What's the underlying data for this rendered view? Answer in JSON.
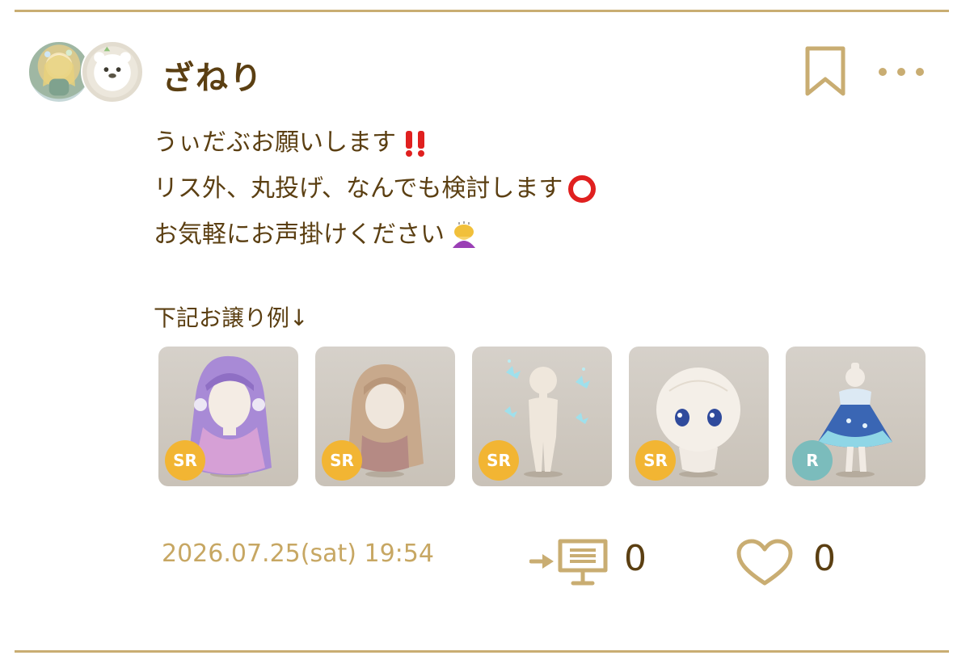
{
  "post": {
    "username": "ざねり",
    "body_lines": [
      "うぃだぶお願いします",
      "リス外、丸投げ、なんでも検討します",
      "お気軽にお声掛けください"
    ],
    "body_emoji_icons": [
      "double-exclamation-icon",
      "red-circle-icon",
      "bowing-person-icon"
    ],
    "section_label": "下記お譲り例↓",
    "items": [
      {
        "rarity": "SR",
        "icon": "purple-long-hair-icon",
        "badge_color": "#f2b533"
      },
      {
        "rarity": "SR",
        "icon": "brown-wavy-hair-icon",
        "badge_color": "#f2b533"
      },
      {
        "rarity": "SR",
        "icon": "butterfly-body-icon",
        "badge_color": "#f2b533"
      },
      {
        "rarity": "SR",
        "icon": "blue-eyes-face-icon",
        "badge_color": "#f2b533"
      },
      {
        "rarity": "R",
        "icon": "blue-dress-icon",
        "badge_color": "#7bbcbc"
      }
    ],
    "timestamp": "2026.07.25(sat) 19:54",
    "message_count": "0",
    "like_count": "0"
  },
  "colors": {
    "accent": "#c9ad72",
    "text": "#5b3f12",
    "timestamp": "#c7a763"
  }
}
